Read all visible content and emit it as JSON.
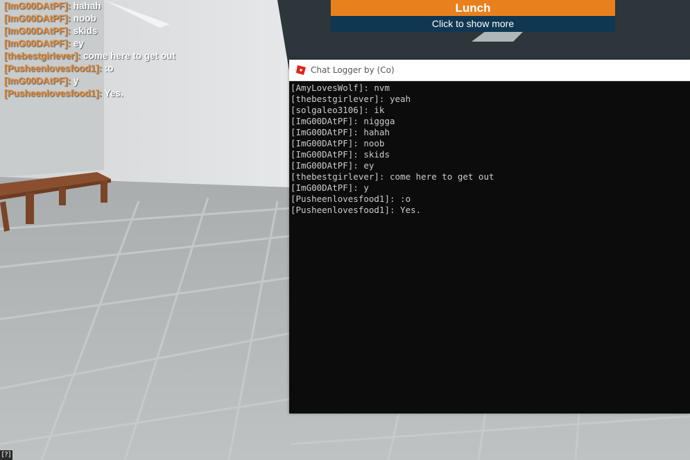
{
  "chat": {
    "lines": [
      {
        "name": "[ImG00DAtPF]:",
        "msg": "hahah"
      },
      {
        "name": "[ImG00DAtPF]:",
        "msg": "noob"
      },
      {
        "name": "[ImG00DAtPF]:",
        "msg": "skids"
      },
      {
        "name": "[ImG00DAtPF]:",
        "msg": "ey"
      },
      {
        "name": "[thebestgirlever]:",
        "msg": "come here to get out"
      },
      {
        "name": "[Pusheenlovesfood1]:",
        "msg": ":o"
      },
      {
        "name": "[ImG00DAtPF]:",
        "msg": "y"
      },
      {
        "name": "[Pusheenlovesfood1]:",
        "msg": "Yes."
      }
    ]
  },
  "banner": {
    "title": "Lunch",
    "subtitle": "Click to show more"
  },
  "logger": {
    "title": "Chat Logger by (Co)",
    "lines": [
      "[AmyLovesWolf]: nvm",
      "[thebestgirlever]: yeah",
      "[solgaleo3106]: ik",
      "[ImG00DAtPF]: niggga",
      "[ImG00DAtPF]: hahah",
      "[ImG00DAtPF]: noob",
      "[ImG00DAtPF]: skids",
      "[ImG00DAtPF]: ey",
      "[thebestgirlever]: come here to get out",
      "[ImG00DAtPF]: y",
      "[Pusheenlovesfood1]: :o",
      "[Pusheenlovesfood1]: Yes."
    ]
  },
  "corner_badge": "[?]",
  "colors": {
    "chat_name": "#e38a36",
    "banner_orange": "#e8801d",
    "banner_navy": "#0f3752",
    "logger_bg": "#0c0c0c"
  },
  "icons": {
    "logger_icon": "roblox-logo-icon"
  }
}
